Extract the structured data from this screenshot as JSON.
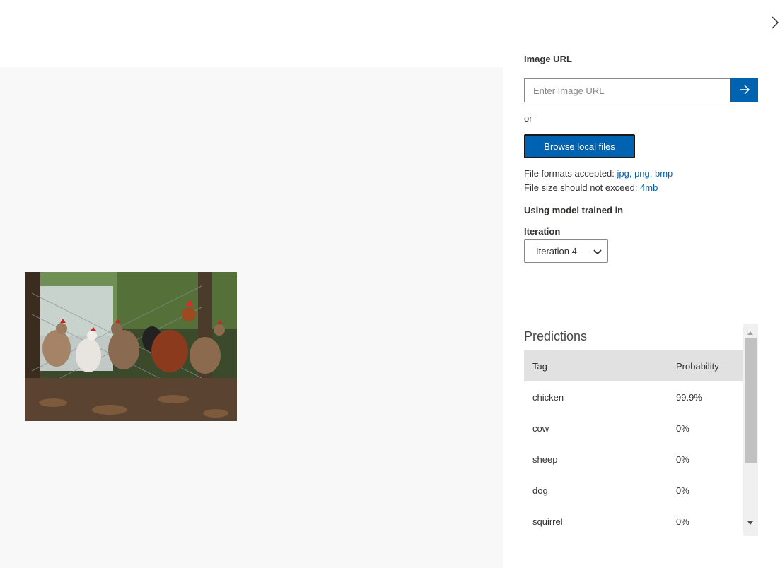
{
  "header": {
    "close_icon": "chevron-right-icon"
  },
  "image_panel": {
    "background": "#f8f8f8"
  },
  "form": {
    "image_url_label": "Image URL",
    "url_placeholder": "Enter Image URL",
    "url_value": "",
    "go_icon": "arrow-right-icon",
    "or_text": "or",
    "browse_label": "Browse local files",
    "formats_prefix": "File formats accepted: ",
    "formats_value": "jpg, png, bmp",
    "size_prefix": "File size should not exceed: ",
    "size_value": "4mb",
    "model_label": "Using model trained in",
    "iteration_label": "Iteration",
    "iteration_selected": "Iteration 4"
  },
  "predictions": {
    "title": "Predictions",
    "columns": {
      "tag": "Tag",
      "probability": "Probability"
    },
    "rows": [
      {
        "tag": "chicken",
        "probability": "99.9%"
      },
      {
        "tag": "cow",
        "probability": "0%"
      },
      {
        "tag": "sheep",
        "probability": "0%"
      },
      {
        "tag": "dog",
        "probability": "0%"
      },
      {
        "tag": "squirrel",
        "probability": "0%"
      }
    ]
  },
  "colors": {
    "accent": "#0063b1",
    "link": "#0063b1",
    "header_row": "#e1e1e1"
  }
}
